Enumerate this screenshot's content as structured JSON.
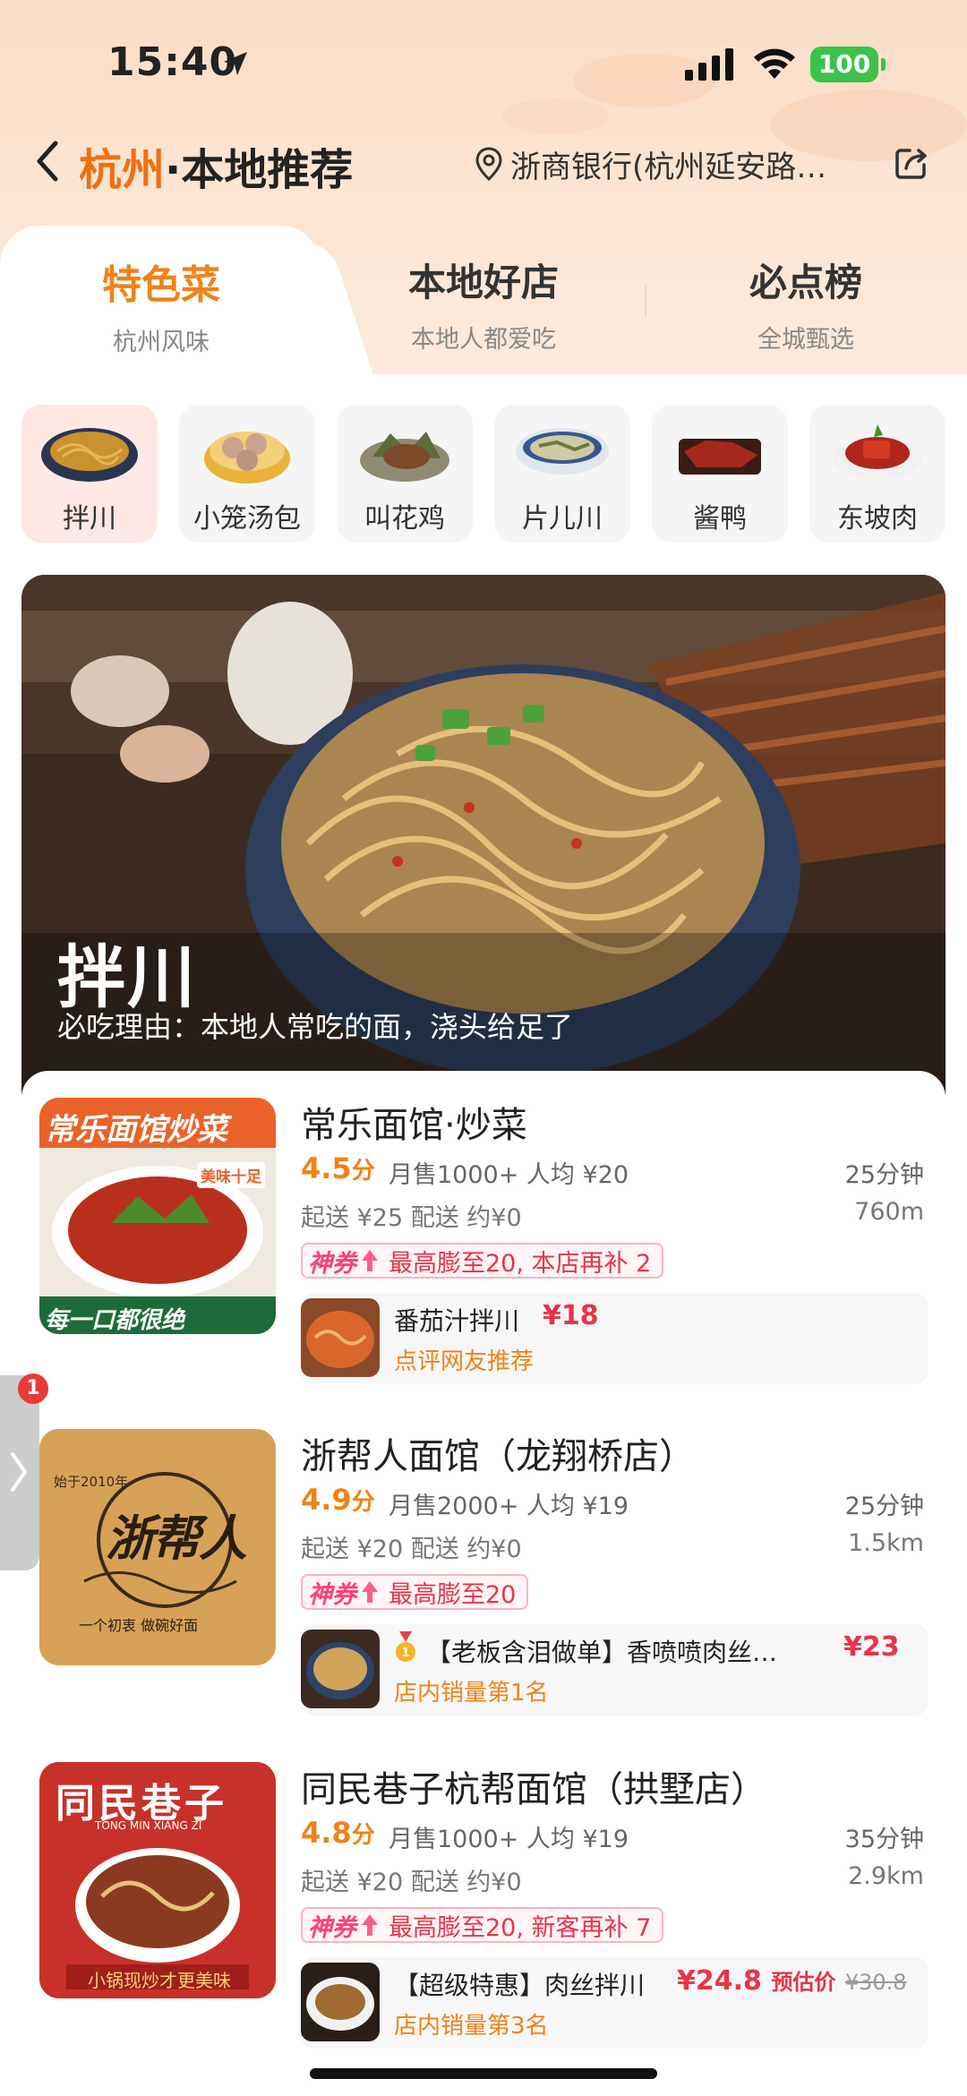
{
  "status_bar": {
    "time": "15:40",
    "battery": "100"
  },
  "header": {
    "city": "杭州",
    "sep_title": "·本地推荐",
    "location": "浙商银行(杭州延安路…"
  },
  "tabs": [
    {
      "label": "特色菜",
      "sub": "杭州风味",
      "active": true
    },
    {
      "label": "本地好店",
      "sub": "本地人都爱吃",
      "active": false
    },
    {
      "label": "必点榜",
      "sub": "全城甄选",
      "active": false
    }
  ],
  "categories": [
    {
      "label": "拌川",
      "selected": true
    },
    {
      "label": "小笼汤包",
      "selected": false
    },
    {
      "label": "叫花鸡",
      "selected": false
    },
    {
      "label": "片儿川",
      "selected": false
    },
    {
      "label": "酱鸭",
      "selected": false
    },
    {
      "label": "东坡肉",
      "selected": false
    }
  ],
  "hero": {
    "title": "拌川",
    "subtitle": "必吃理由：本地人常吃的面，浇头给足了"
  },
  "shops": [
    {
      "name": "常乐面馆·炒菜",
      "rating": "4.5",
      "rating_unit": "分",
      "sales": "月售1000+  人均 ¥20",
      "time": "25分钟",
      "delivery": "起送 ¥25  配送 约¥0",
      "distance": "760m",
      "coupon_tag": "神券",
      "coupon_text": "最高膨至20, 本店再补 2",
      "rec_name": "番茄汁拌川",
      "rec_price": "¥18",
      "rec_tag": "点评网友推荐",
      "thumb_text_top": "常乐面馆炒菜",
      "thumb_text_bottom": "每一口都很绝",
      "thumb_badge": "美味十足"
    },
    {
      "name": "浙帮人面馆（龙翔桥店）",
      "rating": "4.9",
      "rating_unit": "分",
      "sales": "月售2000+  人均 ¥19",
      "time": "25分钟",
      "delivery": "起送 ¥20  配送 约¥0",
      "distance": "1.5km",
      "coupon_tag": "神券",
      "coupon_text": "最高膨至20",
      "rec_name": "【老板含泪做单】香喷喷肉丝…",
      "rec_price": "¥23",
      "rec_tag": "店内销量第1名",
      "thumb_text_top": "始于2010年",
      "thumb_logo": "浙帮人",
      "thumb_text_bottom": "一个初衷  做碗好面"
    },
    {
      "name": "同民巷子杭帮面馆（拱墅店）",
      "rating": "4.8",
      "rating_unit": "分",
      "sales": "月售1000+  人均 ¥19",
      "time": "35分钟",
      "delivery": "起送 ¥20  配送 约¥0",
      "distance": "2.9km",
      "coupon_tag": "神券",
      "coupon_text": "最高膨至20, 新客再补 7",
      "rec_name": "【超级特惠】肉丝拌川",
      "rec_price": "¥24.8",
      "rec_est": "预估价",
      "rec_orig": "¥30.8",
      "rec_tag": "店内销量第3名",
      "thumb_text_top": "同民巷子",
      "thumb_text_sub": "TONG MIN XIANG ZI",
      "thumb_text_bottom": "小锅现炒才更美味"
    }
  ],
  "side_badge": "1",
  "colors": {
    "accent": "#f0821a",
    "price": "#e8334a",
    "header_bg": "#fbe6d5"
  }
}
